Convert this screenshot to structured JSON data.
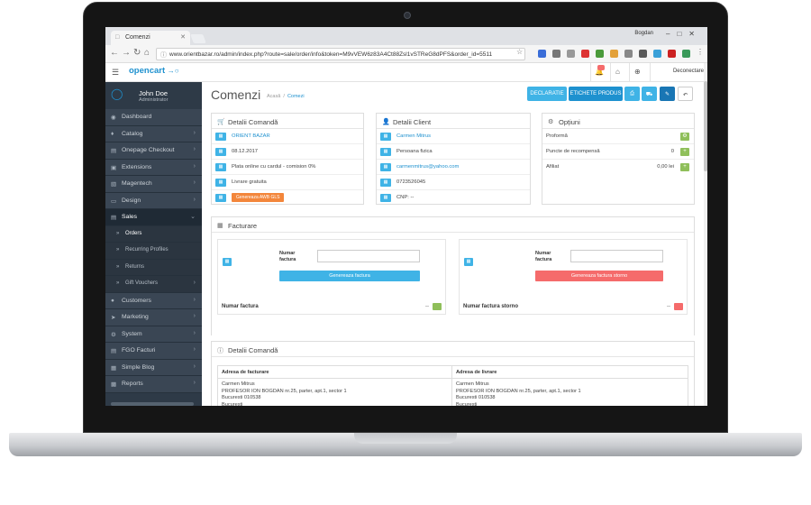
{
  "browser": {
    "tab_title": "Comenzi",
    "profile_name": "Bogdan",
    "url": "www.orientbazar.ro/admin/index.php?route=sale/order/info&token=M9vVEW6z83A4Ct88Zsl1vSTReG8dPFS&order_id=5511"
  },
  "header": {
    "logo": "opencart",
    "logout": "Deconectare"
  },
  "user": {
    "name": "John Doe",
    "role": "Administrator"
  },
  "sidebar": {
    "items": [
      {
        "label": "Dashboard",
        "icon": "dashboard-icon",
        "chevron": false
      },
      {
        "label": "Catalog",
        "icon": "tag-icon",
        "chevron": true
      },
      {
        "label": "Onepage Checkout",
        "icon": "cart-icon",
        "chevron": true
      },
      {
        "label": "Extensions",
        "icon": "puzzle-icon",
        "chevron": true
      },
      {
        "label": "Magentech",
        "icon": "magentech-icon",
        "chevron": true
      },
      {
        "label": "Design",
        "icon": "monitor-icon",
        "chevron": true
      },
      {
        "label": "Sales",
        "icon": "cart-icon",
        "chevron": true,
        "open": true
      },
      {
        "label": "Orders",
        "sub": true,
        "active": true
      },
      {
        "label": "Recurring Profiles",
        "sub": true
      },
      {
        "label": "Returns",
        "sub": true
      },
      {
        "label": "Gift Vouchers",
        "sub": true,
        "chevron": true
      },
      {
        "label": "Customers",
        "icon": "user-icon",
        "chevron": true
      },
      {
        "label": "Marketing",
        "icon": "share-icon",
        "chevron": true
      },
      {
        "label": "System",
        "icon": "gear-icon",
        "chevron": true
      },
      {
        "label": "FGO Facturi",
        "icon": "invoice-icon",
        "chevron": true
      },
      {
        "label": "Simple Blog",
        "icon": "blog-icon",
        "chevron": true
      },
      {
        "label": "Reports",
        "icon": "chart-icon",
        "chevron": true
      }
    ]
  },
  "page": {
    "title": "Comenzi",
    "breadcrumb_home": "Acasă",
    "breadcrumb_current": "Comezi",
    "buttons": {
      "declaratie": "DECLARATIE",
      "etichete": "ETICHETE PRODUS"
    }
  },
  "detalii_comanda": {
    "title": "Detalii Comandă",
    "rows": [
      "ORIENT BAZAR",
      "08.12.2017",
      "Plata online cu cardul - comision 0%",
      "Livrare gratuita"
    ],
    "awb_button": "Genereaza AWB GLS"
  },
  "detalii_client": {
    "title": "Detalii Client",
    "rows": [
      "Carmen Mitrus",
      "Persoana fizica",
      "carmenmitrus@yahoo.com",
      "0723526045",
      "CNP: --"
    ]
  },
  "optiuni": {
    "title": "Opțiuni",
    "rows": [
      {
        "label": "Proformă",
        "value": ""
      },
      {
        "label": "Puncte de recompensă",
        "value": "0"
      },
      {
        "label": "Afiliat",
        "value": "0,00 lei"
      }
    ]
  },
  "facturare": {
    "title": "Facturare",
    "left": {
      "label": "Numar factura",
      "button": "Genereaza factura",
      "footer": "Numar factura",
      "value": "--"
    },
    "right": {
      "label": "Numar factura",
      "button": "Genereaza factura storno",
      "footer": "Numar factura storno",
      "value": "--"
    }
  },
  "detalii_comanda_2": {
    "title": "Detalii Comandă",
    "billing_header": "Adresa de facturare",
    "shipping_header": "Adresa de livrare",
    "billing": [
      "Carmen Mitrus",
      "PROFESOR ION BOGDAN nr.25, parter, apt.1, sector 1",
      "Bucuresti 010538",
      "Bucuresti",
      "Romania",
      "CNP: --"
    ],
    "shipping": [
      "Carmen Mitrus",
      "PROFESOR ION BOGDAN nr.25, parter, apt.1, sector 1",
      "Bucuresti 010538",
      "Bucuresti",
      "Romania"
    ]
  },
  "colors": {
    "accent": "#1e91cf",
    "sidebar": "#2e3a47",
    "orange": "#f3863b",
    "red": "#f56b6b",
    "green": "#8fbf5a"
  }
}
